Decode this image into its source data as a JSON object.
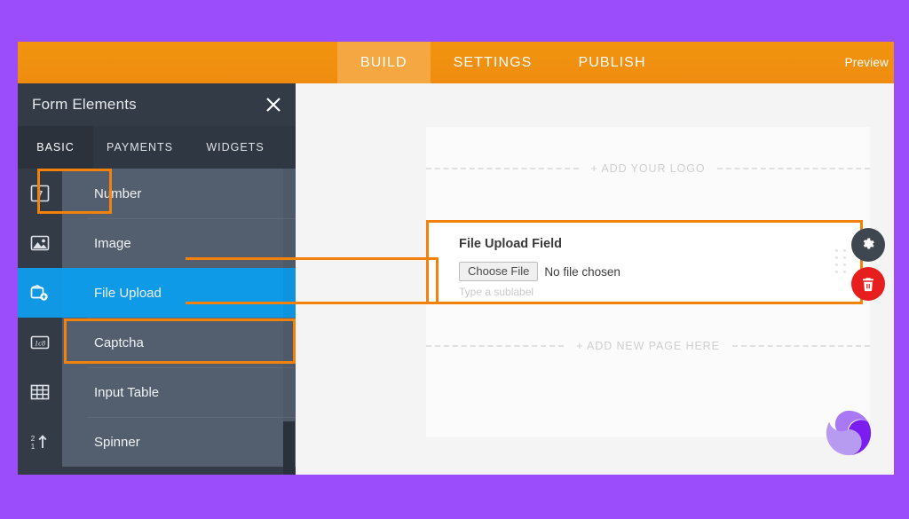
{
  "topbar": {
    "tabs": [
      {
        "label": "BUILD",
        "active": true
      },
      {
        "label": "SETTINGS",
        "active": false
      },
      {
        "label": "PUBLISH",
        "active": false
      }
    ],
    "preview_label": "Preview"
  },
  "sidebar": {
    "title": "Form Elements",
    "close_icon": "close-icon",
    "tabs": [
      {
        "label": "BASIC",
        "active": true
      },
      {
        "label": "PAYMENTS",
        "active": false
      },
      {
        "label": "WIDGETS",
        "active": false
      }
    ],
    "items": [
      {
        "label": "Number",
        "icon": "number-icon",
        "selected": false
      },
      {
        "label": "Image",
        "icon": "image-icon",
        "selected": false
      },
      {
        "label": "File Upload",
        "icon": "file-upload-icon",
        "selected": true
      },
      {
        "label": "Captcha",
        "icon": "captcha-icon",
        "selected": false
      },
      {
        "label": "Input Table",
        "icon": "input-table-icon",
        "selected": false
      },
      {
        "label": "Spinner",
        "icon": "spinner-icon",
        "selected": false
      }
    ]
  },
  "canvas": {
    "add_logo_label": "+ ADD YOUR LOGO",
    "add_page_label": "+ ADD NEW PAGE HERE",
    "field": {
      "label": "File Upload Field",
      "choose_file_label": "Choose File",
      "no_file_text": "No file chosen",
      "sublabel_placeholder": "Type a sublabel"
    },
    "actions": {
      "settings_icon": "gear-icon",
      "delete_icon": "trash-icon"
    }
  },
  "colors": {
    "page_background": "#9b4dfb",
    "topbar_orange": "#f2900f",
    "topbar_active_tab": "#f5a742",
    "sidebar_dark": "#333b47",
    "sidebar_row": "#535e6e",
    "selected_blue": "#0f9ae8",
    "highlight_orange": "#f2820c",
    "delete_red": "#e61e1e",
    "canvas_gray": "#f4f4f4"
  }
}
